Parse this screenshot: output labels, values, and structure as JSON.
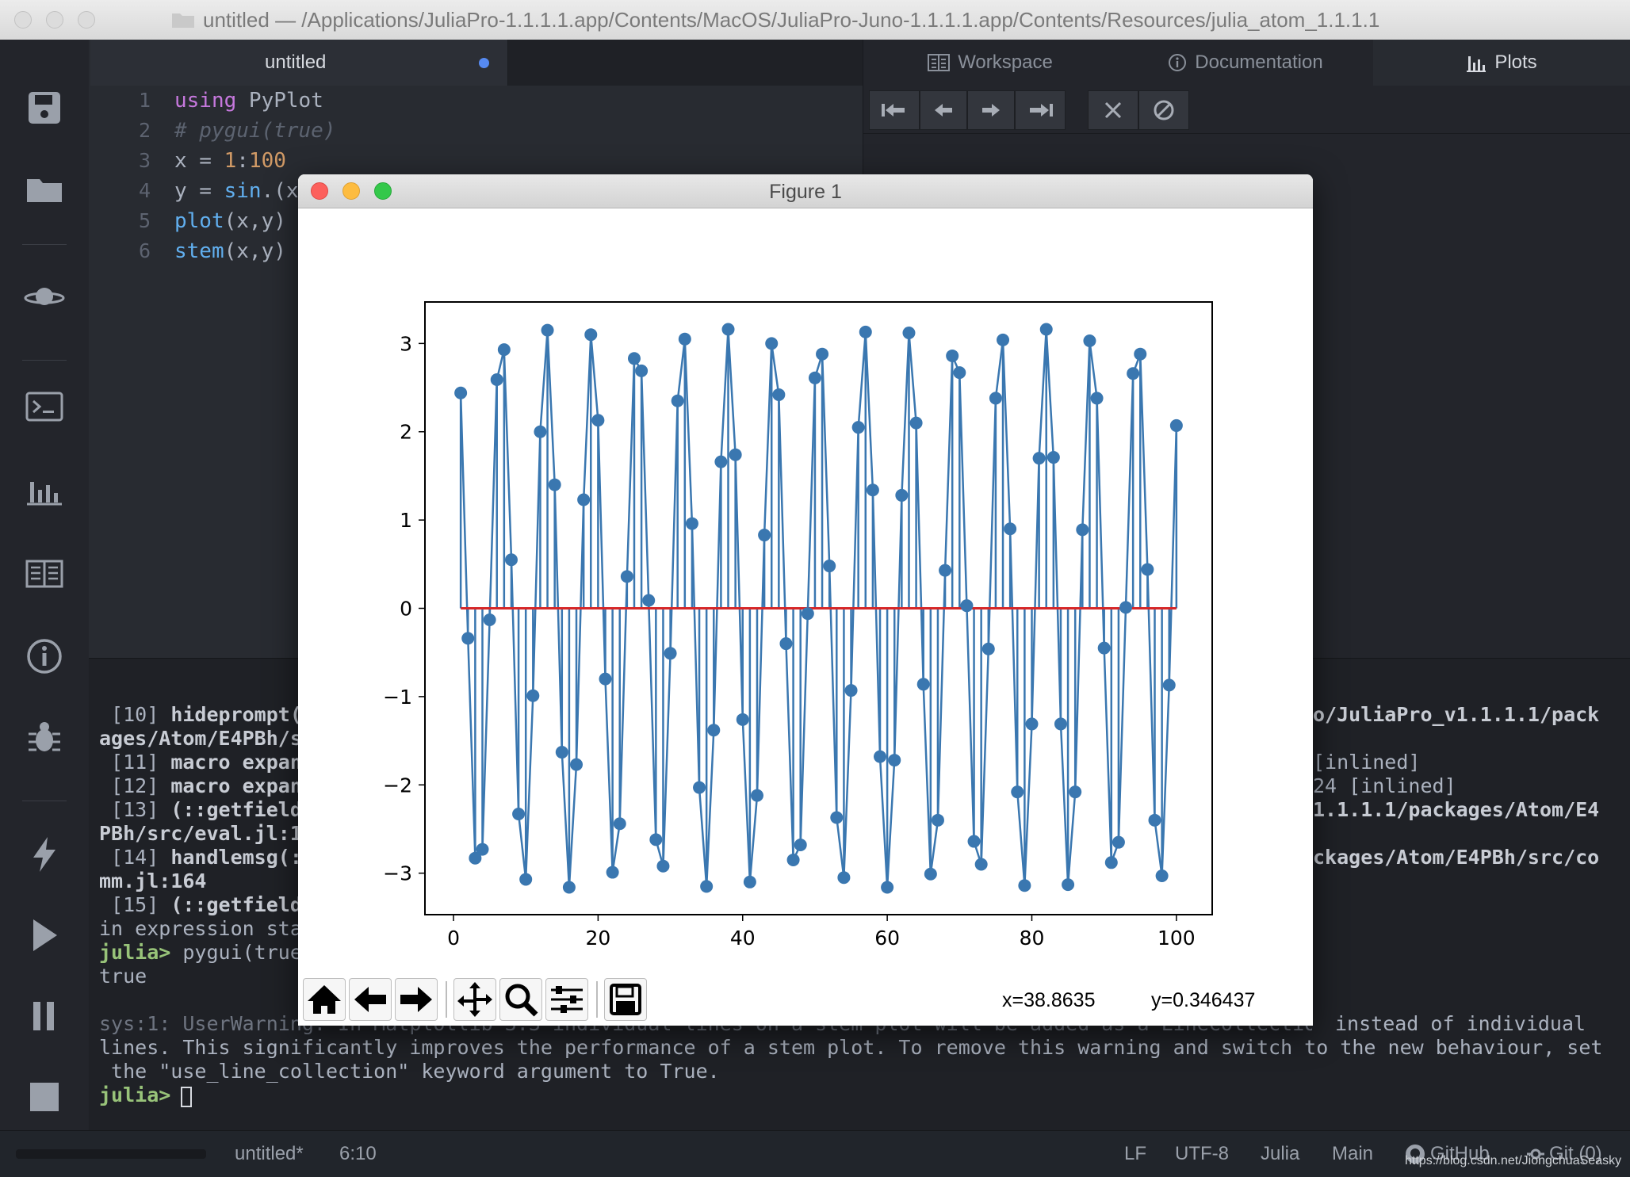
{
  "window": {
    "title": "untitled — /Applications/JuliaPro-1.1.1.1.app/Contents/MacOS/JuliaPro-Juno-1.1.1.1.app/Contents/Resources/julia_atom_1.1.1.1"
  },
  "sidebar": {
    "icons": [
      "save-icon",
      "folder-icon",
      "planet-icon",
      "terminal-icon",
      "plots-icon",
      "docs-icon",
      "info-icon",
      "bug-icon",
      "lightning-icon",
      "play-icon",
      "pause-icon",
      "stop-icon"
    ]
  },
  "editor": {
    "tab_label": "untitled",
    "line_numbers": [
      "1",
      "2",
      "3",
      "4",
      "5",
      "6"
    ],
    "lines": [
      {
        "parts": [
          {
            "t": "using",
            "c": "kw"
          },
          {
            "t": " PyPlot",
            "c": ""
          }
        ]
      },
      {
        "parts": [
          {
            "t": "# pygui(true)",
            "c": "cm"
          }
        ]
      },
      {
        "parts": [
          {
            "t": "x = ",
            "c": ""
          },
          {
            "t": "1",
            "c": "num"
          },
          {
            "t": ":",
            "c": ""
          },
          {
            "t": "100",
            "c": "num"
          }
        ]
      },
      {
        "parts": [
          {
            "t": "y = ",
            "c": ""
          },
          {
            "t": "sin",
            "c": "fn"
          },
          {
            "t": ".(x",
            "c": ""
          }
        ]
      },
      {
        "parts": [
          {
            "t": "plot",
            "c": "fn"
          },
          {
            "t": "(x,y)",
            "c": ""
          }
        ]
      },
      {
        "parts": [
          {
            "t": "stem",
            "c": "fn"
          },
          {
            "t": "(x,y)",
            "c": ""
          }
        ]
      }
    ]
  },
  "right_pane": {
    "tabs": [
      {
        "label": "Workspace",
        "icon": "workspace-icon"
      },
      {
        "label": "Documentation",
        "icon": "info-icon"
      },
      {
        "label": "Plots",
        "icon": "plots-icon"
      }
    ],
    "toolbar_buttons": [
      "first-icon",
      "previous-icon",
      "next-icon",
      "last-icon",
      "close-icon",
      "clear-icon"
    ]
  },
  "console": {
    "lines_left": [
      [
        {
          "t": " [10] ",
          "c": ""
        },
        {
          "t": "hideprompt(",
          "c": "b"
        }
      ],
      [
        {
          "t": "ages/Atom/E4PBh/s",
          "c": "b"
        }
      ],
      [
        {
          "t": " [11] ",
          "c": ""
        },
        {
          "t": "macro expan",
          "c": "b"
        }
      ],
      [
        {
          "t": " [12] ",
          "c": ""
        },
        {
          "t": "macro expan",
          "c": "b"
        }
      ],
      [
        {
          "t": " [13] ",
          "c": ""
        },
        {
          "t": "(::getfield",
          "c": "b"
        }
      ],
      [
        {
          "t": "PBh/src/eval.jl:1",
          "c": "b"
        }
      ],
      [
        {
          "t": " [14] ",
          "c": ""
        },
        {
          "t": "handlemsg(:",
          "c": "b"
        }
      ],
      [
        {
          "t": "mm.jl:164",
          "c": "b"
        }
      ],
      [
        {
          "t": " [15] ",
          "c": ""
        },
        {
          "t": "(::getfield",
          "c": "b"
        }
      ],
      [
        {
          "t": "in expression sta",
          "c": ""
        }
      ],
      [
        {
          "t": "julia>",
          "c": "g"
        },
        {
          "t": " pygui(true",
          "c": ""
        }
      ],
      [
        {
          "t": "true",
          "c": ""
        }
      ]
    ],
    "lines_right": [
      {
        "row": 0,
        "t": "o/JuliaPro_v1.1.1.1/pack",
        "c": "b"
      },
      {
        "row": 2,
        "t": "[inlined]",
        "c": ""
      },
      {
        "row": 3,
        "t": "24 [inlined]",
        "c": ""
      },
      {
        "row": 4,
        "t": "1.1.1.1/packages/Atom/E4",
        "c": "b"
      },
      {
        "row": 6,
        "t": "ckages/Atom/E4PBh/src/co",
        "c": "b"
      }
    ],
    "warning_line1_tail": "instead of individual",
    "warning_line1_partial": "sys:1: UserWarning: In Matplotlib 3.3 individual lines on a stem plot will be added as a LineCollection",
    "warning_line2": "lines. This significantly improves the performance of a stem plot. To remove this warning and switch to the new behaviour, set",
    "warning_line3": " the \"use_line_collection\" keyword argument to True.",
    "prompt": "julia>"
  },
  "statusbar": {
    "file": "untitled*",
    "position": "6:10",
    "line_ending": "LF",
    "encoding": "UTF-8",
    "grammar": "Julia",
    "module": "Main",
    "github": "GitHub",
    "git": "Git (0)"
  },
  "watermark": "https://blog.csdn.net/JiongchuaSeasky",
  "figure": {
    "title": "Figure 1",
    "coords_x": "x=38.8635",
    "coords_y": "y=0.346437",
    "toolbar": [
      "home-icon",
      "back-icon",
      "forward-icon",
      "pan-icon",
      "zoom-icon",
      "configure-icon",
      "save-icon"
    ]
  },
  "chart_data": {
    "type": "stem",
    "title": "",
    "xlabel": "",
    "ylabel": "",
    "function": "plot(x,y) and stem(x,y) of y = sin.(x) * pi with x = 1:100",
    "x": [
      1,
      2,
      3,
      4,
      5,
      6,
      7,
      8,
      9,
      10,
      11,
      12,
      13,
      14,
      15,
      16,
      17,
      18,
      19,
      20,
      21,
      22,
      23,
      24,
      25,
      26,
      27,
      28,
      29,
      30,
      31,
      32,
      33,
      34,
      35,
      36,
      37,
      38,
      39,
      40,
      41,
      42,
      43,
      44,
      45,
      46,
      47,
      48,
      49,
      50,
      51,
      52,
      53,
      54,
      55,
      56,
      57,
      58,
      59,
      60,
      61,
      62,
      63,
      64,
      65,
      66,
      67,
      68,
      69,
      70,
      71,
      72,
      73,
      74,
      75,
      76,
      77,
      78,
      79,
      80,
      81,
      82,
      83,
      84,
      85,
      86,
      87,
      88,
      89,
      90,
      91,
      92,
      93,
      94,
      95,
      96,
      97,
      98,
      99,
      100
    ],
    "y": [
      2.44,
      -0.34,
      -2.83,
      -2.73,
      -0.13,
      2.59,
      2.93,
      0.55,
      -2.33,
      -3.07,
      -0.99,
      2.0,
      3.15,
      1.4,
      -1.63,
      -3.16,
      -1.77,
      1.23,
      3.1,
      2.13,
      -0.8,
      -2.99,
      -2.44,
      0.36,
      2.83,
      2.69,
      0.09,
      -2.62,
      -2.92,
      -0.51,
      2.35,
      3.05,
      0.96,
      -2.03,
      -3.15,
      -1.38,
      1.66,
      3.16,
      1.74,
      -1.26,
      -3.1,
      -2.12,
      0.83,
      3.0,
      2.42,
      -0.4,
      -2.85,
      -2.68,
      -0.06,
      2.61,
      2.88,
      0.48,
      -2.37,
      -3.05,
      -0.93,
      2.05,
      3.13,
      1.34,
      -1.68,
      -3.16,
      -1.72,
      1.28,
      3.12,
      2.1,
      -0.86,
      -3.01,
      -2.4,
      0.43,
      2.86,
      2.67,
      0.03,
      -2.64,
      -2.9,
      -0.46,
      2.38,
      3.04,
      0.9,
      -2.08,
      -3.14,
      -1.31,
      1.7,
      3.16,
      1.71,
      -1.31,
      -3.13,
      -2.08,
      0.89,
      3.03,
      2.38,
      -0.45,
      -2.88,
      -2.65,
      0.01,
      2.66,
      2.88,
      0.44,
      -2.4,
      -3.03,
      -0.87,
      2.07
    ],
    "xlim": [
      -3.95,
      104.95
    ],
    "ylim": [
      -3.47,
      3.47
    ],
    "xticks": [
      0,
      20,
      40,
      60,
      80,
      100
    ],
    "yticks": [
      -3,
      -2,
      -1,
      0,
      1,
      2,
      3
    ],
    "xtick_labels": [
      "0",
      "20",
      "40",
      "60",
      "80",
      "100"
    ],
    "ytick_labels": [
      "−3",
      "−2",
      "−1",
      "0",
      "1",
      "2",
      "3"
    ],
    "line_color": "#3a77b0",
    "marker_color": "#3a77b0",
    "baseline_color": "#d62728",
    "grid": false
  }
}
